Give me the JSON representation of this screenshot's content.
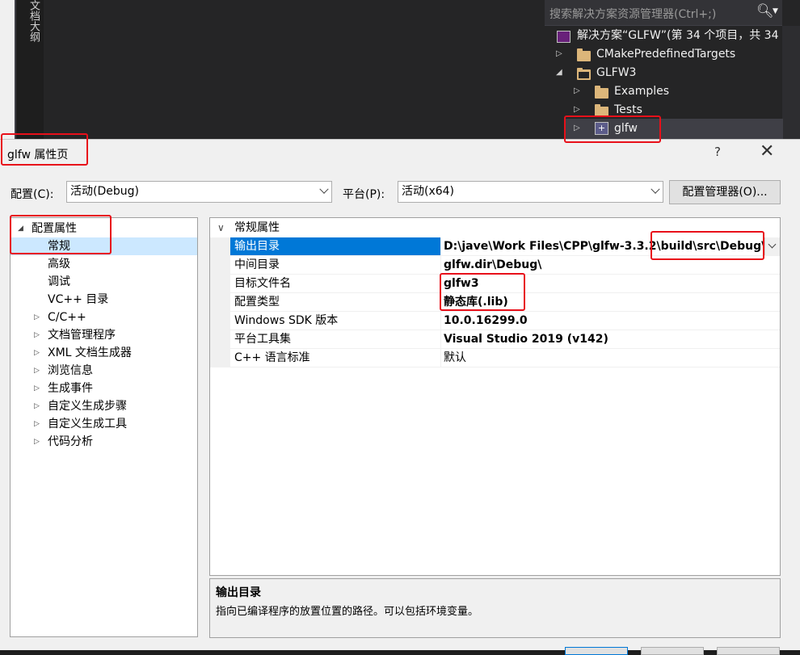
{
  "background": {
    "outline_tab": "文档大纲"
  },
  "solution_explorer": {
    "search_placeholder": "搜索解决方案资源管理器(Ctrl+;)",
    "solution_label": "解决方案“GLFW”(第 34 个项目，共 34",
    "items": [
      {
        "label": "CMakePredefinedTargets",
        "expanded": false,
        "type": "folder"
      },
      {
        "label": "GLFW3",
        "expanded": true,
        "type": "folder-open"
      },
      {
        "label": "Examples",
        "expanded": false,
        "type": "folder"
      },
      {
        "label": "Tests",
        "expanded": false,
        "type": "folder"
      },
      {
        "label": "glfw",
        "expanded": false,
        "type": "project",
        "selected": true
      }
    ]
  },
  "dialog": {
    "title": "glfw 属性页",
    "help": "?",
    "close": "✕",
    "config_label": "配置(C):",
    "config_value": "活动(Debug)",
    "platform_label": "平台(P):",
    "platform_value": "活动(x64)",
    "config_manager_button": "配置管理器(O)...",
    "tree": {
      "root": "配置属性",
      "items": [
        {
          "label": "常规",
          "selected": true,
          "expandable": false
        },
        {
          "label": "高级",
          "expandable": false
        },
        {
          "label": "调试",
          "expandable": false
        },
        {
          "label": "VC++ 目录",
          "expandable": false
        },
        {
          "label": "C/C++",
          "expandable": true
        },
        {
          "label": "文档管理程序",
          "expandable": true
        },
        {
          "label": "XML 文档生成器",
          "expandable": true
        },
        {
          "label": "浏览信息",
          "expandable": true
        },
        {
          "label": "生成事件",
          "expandable": true
        },
        {
          "label": "自定义生成步骤",
          "expandable": true
        },
        {
          "label": "自定义生成工具",
          "expandable": true
        },
        {
          "label": "代码分析",
          "expandable": true
        }
      ]
    },
    "grid": {
      "section": "常规属性",
      "rows": [
        {
          "name": "输出目录",
          "value": "D:\\jave\\Work Files\\CPP\\glfw-3.3.2\\build\\src\\Debug\\",
          "bold": true,
          "selected": true
        },
        {
          "name": "中间目录",
          "value": "glfw.dir\\Debug\\",
          "bold": true
        },
        {
          "name": "目标文件名",
          "value": "glfw3",
          "bold": true
        },
        {
          "name": "配置类型",
          "value": "静态库(.lib)",
          "bold": true
        },
        {
          "name": "Windows SDK 版本",
          "value": "10.0.16299.0",
          "bold": true
        },
        {
          "name": "平台工具集",
          "value": "Visual Studio 2019 (v142)",
          "bold": true
        },
        {
          "name": "C++ 语言标准",
          "value": "默认",
          "bold": false
        }
      ]
    },
    "description": {
      "title": "输出目录",
      "text": "指向已编译程序的放置位置的路径。可以包括环境变量。"
    }
  },
  "colors": {
    "selection_blue": "#0078d7",
    "tree_selection": "#cce8ff",
    "annotation_red": "#e8101a",
    "vs_dark": "#252526"
  }
}
